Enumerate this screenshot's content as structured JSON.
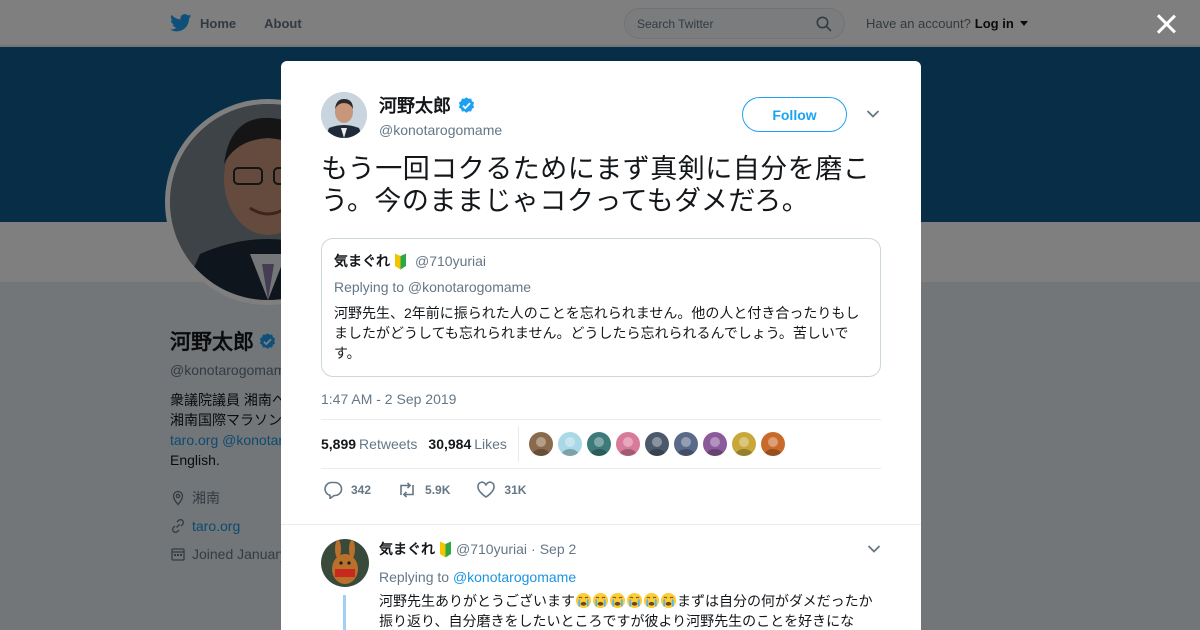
{
  "topbar": {
    "home_label": "Home",
    "about_label": "About",
    "search_placeholder": "Search Twitter",
    "account_prompt": "Have an account?",
    "login_label": "Log in"
  },
  "profile": {
    "name": "河野太郎",
    "handle": "@konotarogomame",
    "bio_line1": "衆議院議員 湘南へ",
    "bio_line2": "湘南国際マラソン",
    "bio_link1": "taro.org",
    "bio_link2": "@konotaro",
    "bio_line4": "English.",
    "location": "湘南",
    "website": "taro.org",
    "joined": "Joined January"
  },
  "tweet": {
    "author_name": "河野太郎",
    "author_handle": "@konotarogomame",
    "follow_label": "Follow",
    "text": "もう一回コクるためにまず真剣に自分を磨こう。今のままじゃコクってもダメだろ。",
    "timestamp": "1:47 AM - 2 Sep 2019",
    "retweets_count": "5,899",
    "retweets_label": "Retweets",
    "likes_count": "30,984",
    "likes_label": "Likes",
    "action_reply_count": "342",
    "action_retweet_count": "5.9K",
    "action_like_count": "31K",
    "liker_avatar_colors": [
      "#8a6a4a",
      "#a9d8e6",
      "#3d7a7a",
      "#d87a9a",
      "#4a5a6a",
      "#5a6a8a",
      "#8a5a9a",
      "#c9a83a",
      "#c96a2a"
    ]
  },
  "quoted": {
    "name": "気まぐれ",
    "handle": "@710yuriai",
    "replying_to": "Replying to @konotarogomame",
    "text": "河野先生、2年前に振られた人のことを忘れられません。他の人と付き合ったりもしましたがどうしても忘れられません。どうしたら忘れられるんでしょう。苦しいです。"
  },
  "reply": {
    "name": "気まぐれ",
    "handle": "@710yuriai",
    "dot": "·",
    "date": "Sep 2",
    "replying_prefix": "Replying to",
    "replying_handle": "@konotarogomame",
    "text_start": "河野先生ありがとうございます",
    "text_end": "まずは自分の何がダメだったか振り返り、自分磨きをしたいところですが彼より河野先生のことを好きにな"
  },
  "colors": {
    "twitter_blue": "#1da1f2",
    "banner": "#0f5a8e",
    "text_gray": "#657786"
  }
}
